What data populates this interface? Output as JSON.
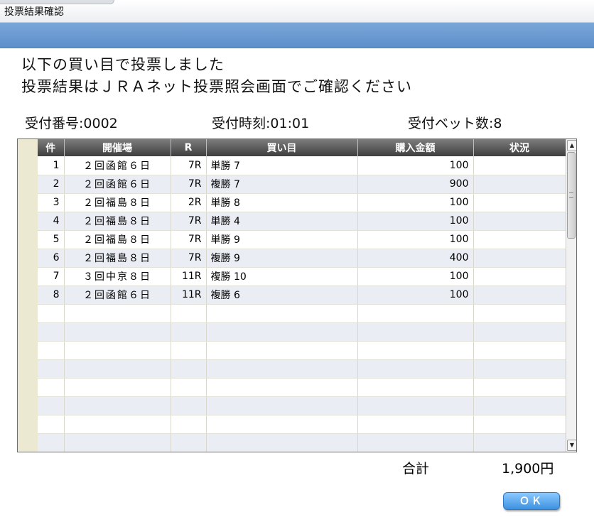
{
  "window": {
    "title": "投票結果確認"
  },
  "message": {
    "line1": "以下の買い目で投票しました",
    "line2": "投票結果はＪＲＡネット投票照会画面でご確認ください"
  },
  "info": {
    "receipt_number": "受付番号:0002",
    "receipt_time": "受付時刻:01:01",
    "bet_count": "受付ベット数:8"
  },
  "table": {
    "headers": [
      "件",
      "開催場",
      "R",
      "買い目",
      "購入金額",
      "状況"
    ],
    "rows": [
      [
        "1",
        "２回函館６日",
        "7R",
        "単勝 7",
        "100",
        ""
      ],
      [
        "2",
        "２回函館６日",
        "7R",
        "複勝 7",
        "900",
        ""
      ],
      [
        "3",
        "２回福島８日",
        "2R",
        "単勝 8",
        "100",
        ""
      ],
      [
        "4",
        "２回福島８日",
        "7R",
        "単勝 4",
        "100",
        ""
      ],
      [
        "5",
        "２回福島８日",
        "7R",
        "単勝 9",
        "100",
        ""
      ],
      [
        "6",
        "２回福島８日",
        "7R",
        "複勝 9",
        "400",
        ""
      ],
      [
        "7",
        "３回中京８日",
        "11R",
        "複勝 10",
        "100",
        ""
      ],
      [
        "8",
        "２回函館６日",
        "11R",
        "複勝 6",
        "100",
        ""
      ],
      [
        "",
        "",
        "",
        "",
        "",
        ""
      ],
      [
        "",
        "",
        "",
        "",
        "",
        ""
      ],
      [
        "",
        "",
        "",
        "",
        "",
        ""
      ],
      [
        "",
        "",
        "",
        "",
        "",
        ""
      ],
      [
        "",
        "",
        "",
        "",
        "",
        ""
      ],
      [
        "",
        "",
        "",
        "",
        "",
        ""
      ],
      [
        "",
        "",
        "",
        "",
        "",
        ""
      ],
      [
        "",
        "",
        "",
        "",
        "",
        ""
      ]
    ]
  },
  "total": {
    "label": "合計",
    "value": "1,900円"
  },
  "buttons": {
    "ok": "ＯＫ"
  },
  "icons": {
    "scroll_up": "scroll-up-arrow",
    "scroll_down": "scroll-down-arrow"
  }
}
